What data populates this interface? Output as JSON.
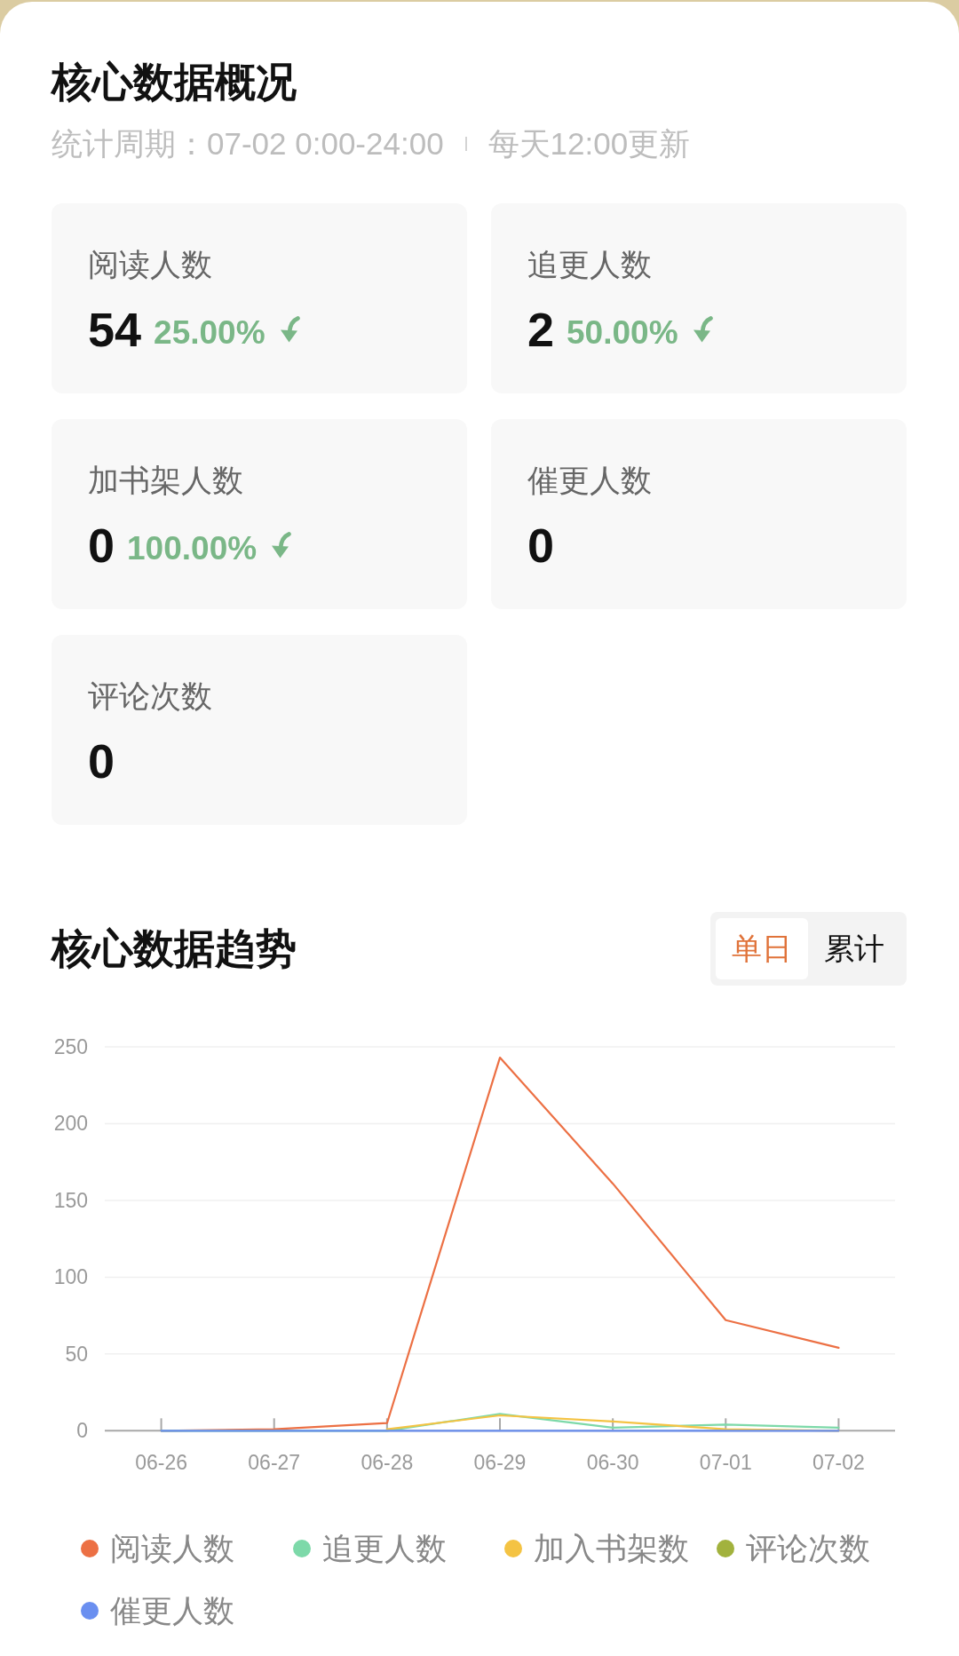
{
  "overview": {
    "title": "核心数据概况",
    "period": "统计周期：07-02 0:00-24:00",
    "update_note": "每天12:00更新",
    "metrics": [
      {
        "label": "阅读人数",
        "value": "54",
        "change": "25.00%",
        "decline": true
      },
      {
        "label": "追更人数",
        "value": "2",
        "change": "50.00%",
        "decline": true
      },
      {
        "label": "加书架人数",
        "value": "0",
        "change": "100.00%",
        "decline": true
      },
      {
        "label": "催更人数",
        "value": "0"
      },
      {
        "label": "评论次数",
        "value": "0"
      }
    ]
  },
  "trend": {
    "title": "核心数据趋势",
    "toggle": [
      {
        "label": "单日",
        "selected": true
      },
      {
        "label": "累计",
        "selected": false
      }
    ],
    "chart_data": {
      "type": "line",
      "categories": [
        "06-26",
        "06-27",
        "06-28",
        "06-29",
        "06-30",
        "07-01",
        "07-02"
      ],
      "ylim": [
        0,
        250
      ],
      "yticks": [
        0,
        50,
        100,
        150,
        200,
        250
      ],
      "grid": true,
      "legend": true,
      "series": [
        {
          "name": "阅读人数",
          "color": "#ec7044",
          "values": [
            0,
            1,
            5,
            243,
            161,
            72,
            54
          ]
        },
        {
          "name": "追更人数",
          "color": "#7dd9a9",
          "values": [
            0,
            0,
            0,
            11,
            2,
            4,
            2
          ]
        },
        {
          "name": "加入书架数",
          "color": "#f4c343",
          "values": [
            null,
            null,
            1,
            10,
            6,
            1,
            0
          ]
        },
        {
          "name": "评论次数",
          "color": "#a2b23d",
          "values": [
            null,
            null,
            null,
            null,
            null,
            null,
            null
          ]
        },
        {
          "name": "催更人数",
          "color": "#6a8ff0",
          "values": [
            0,
            0,
            0,
            0,
            0,
            0,
            0
          ]
        }
      ]
    }
  }
}
